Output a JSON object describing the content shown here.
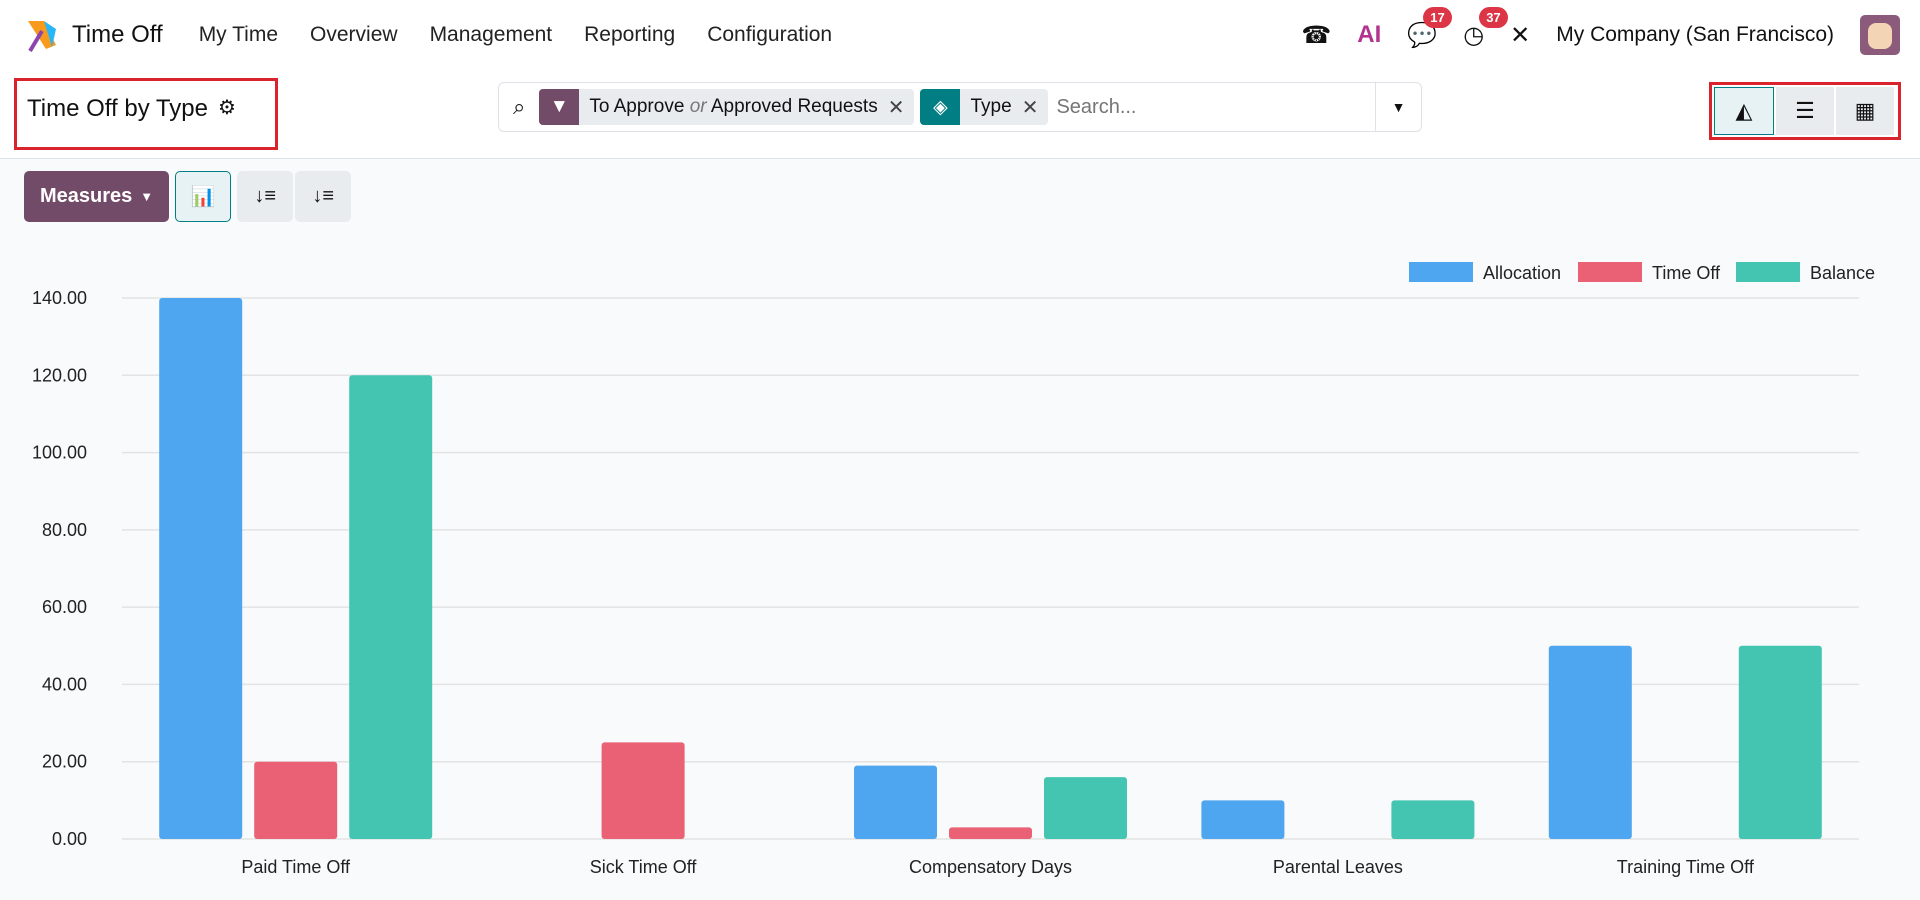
{
  "nav": {
    "app": "Time Off",
    "menu": [
      "My Time",
      "Overview",
      "Management",
      "Reporting",
      "Configuration"
    ],
    "messages_count": "17",
    "activities_count": "37",
    "ai_label": "AI",
    "company": "My Company (San Francisco)"
  },
  "control": {
    "title": "Time Off by Type",
    "facets": [
      {
        "label_a": "To Approve",
        "or": "or",
        "label_b": "Approved Requests",
        "color": "#714b67"
      },
      {
        "label": "Type",
        "color": "#017e84"
      }
    ],
    "search_placeholder": "Search..."
  },
  "toolbar": {
    "measures": "Measures"
  },
  "chart_data": {
    "type": "bar",
    "categories": [
      "Paid Time Off",
      "Sick Time Off",
      "Compensatory Days",
      "Parental Leaves",
      "Training Time Off"
    ],
    "series": [
      {
        "name": "Allocation",
        "color": "#4ea5f0",
        "values": [
          140,
          0,
          19,
          10,
          50
        ]
      },
      {
        "name": "Time Off",
        "color": "#ea6175",
        "values": [
          20,
          25,
          3,
          0,
          0
        ]
      },
      {
        "name": "Balance",
        "color": "#43c5b1",
        "values": [
          120,
          0,
          16,
          10,
          50
        ]
      }
    ],
    "ylim": [
      0,
      140
    ],
    "yticks": [
      "0.00",
      "20.00",
      "40.00",
      "60.00",
      "80.00",
      "100.00",
      "120.00",
      "140.00"
    ],
    "legend": "top-right",
    "grid": true
  }
}
